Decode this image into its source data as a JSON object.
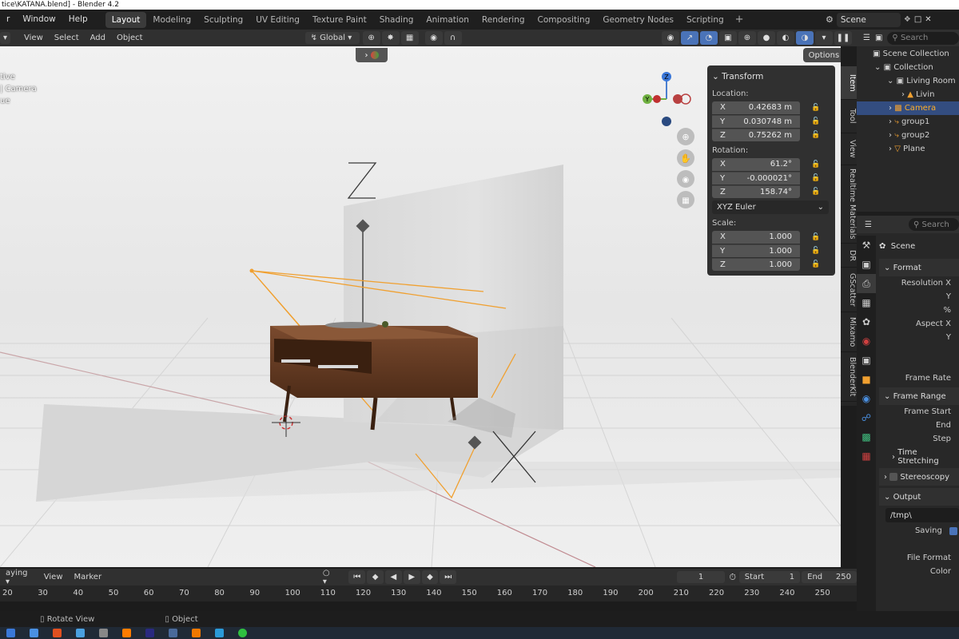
{
  "window": {
    "title": "tice\\KATANA.blend] - Blender 4.2"
  },
  "menus": [
    "r",
    "Window",
    "Help"
  ],
  "workspaces": [
    {
      "label": "Layout",
      "active": true
    },
    {
      "label": "Modeling"
    },
    {
      "label": "Sculpting"
    },
    {
      "label": "UV Editing"
    },
    {
      "label": "Texture Paint"
    },
    {
      "label": "Shading"
    },
    {
      "label": "Animation"
    },
    {
      "label": "Rendering"
    },
    {
      "label": "Compositing"
    },
    {
      "label": "Geometry Nodes"
    },
    {
      "label": "Scripting"
    }
  ],
  "add_workspace": "+",
  "scene": {
    "name": "Scene"
  },
  "viewport_header": {
    "menus": [
      "View",
      "Select",
      "Add",
      "Object"
    ],
    "orientation": "Global",
    "options": "Options"
  },
  "viewport_overlay_text": [
    "tive",
    "| Camera",
    "ue"
  ],
  "gizmo": {
    "z": "Z",
    "y": "Y"
  },
  "npanel": {
    "title": "Transform",
    "location_label": "Location:",
    "location": [
      {
        "axis": "X",
        "value": "0.42683 m"
      },
      {
        "axis": "Y",
        "value": "0.030748 m"
      },
      {
        "axis": "Z",
        "value": "0.75262 m"
      }
    ],
    "rotation_label": "Rotation:",
    "rotation": [
      {
        "axis": "X",
        "value": "61.2°"
      },
      {
        "axis": "Y",
        "value": "-0.000021°"
      },
      {
        "axis": "Z",
        "value": "158.74°"
      }
    ],
    "rotation_mode": "XYZ Euler",
    "scale_label": "Scale:",
    "scale": [
      {
        "axis": "X",
        "value": "1.000"
      },
      {
        "axis": "Y",
        "value": "1.000"
      },
      {
        "axis": "Z",
        "value": "1.000"
      }
    ]
  },
  "side_tabs": [
    "Item",
    "Tool",
    "View",
    "Realtime Materials",
    "DR",
    "GScatter",
    "Mixamo",
    "BlenderKit"
  ],
  "outliner": {
    "search_placeholder": "Search",
    "rows": [
      {
        "label": "Scene Collection",
        "indent": 0
      },
      {
        "label": "Collection",
        "indent": 1
      },
      {
        "label": "Living Room",
        "indent": 2
      },
      {
        "label": "Livin",
        "indent": 3
      },
      {
        "label": "Camera",
        "indent": 1,
        "selected": true
      },
      {
        "label": "group1",
        "indent": 1
      },
      {
        "label": "group2",
        "indent": 1
      },
      {
        "label": "Plane",
        "indent": 1
      }
    ]
  },
  "properties": {
    "search_placeholder": "Search",
    "scene_label": "Scene",
    "format_label": "Format",
    "resolution_x": "Resolution X",
    "y_label": "Y",
    "percent_label": "%",
    "aspect_x": "Aspect X",
    "aspect_y": "Y",
    "frame_rate": "Frame Rate",
    "frame_range_label": "Frame Range",
    "frame_start": "Frame Start",
    "end": "End",
    "step": "Step",
    "time_stretching": "Time Stretching",
    "stereoscopy": "Stereoscopy",
    "output_label": "Output",
    "output_path": "/tmp\\",
    "saving": "Saving",
    "file_format": "File Format",
    "color": "Color"
  },
  "timeline": {
    "playback": "aying",
    "view": "View",
    "marker": "Marker",
    "current_frame": "1",
    "start_label": "Start",
    "start": "1",
    "end_label": "End",
    "end": "250",
    "ticks": [
      "20",
      "30",
      "40",
      "50",
      "60",
      "70",
      "80",
      "90",
      "100",
      "110",
      "120",
      "130",
      "140",
      "150",
      "160",
      "170",
      "180",
      "190",
      "200",
      "210",
      "220",
      "230",
      "240",
      "250"
    ]
  },
  "statusbar": {
    "rotate": "Rotate View",
    "object": "Object"
  },
  "colors": {
    "accent": "#4a73b8",
    "selected_text": "#ffaf29",
    "camera_orange": "#f0a030"
  }
}
